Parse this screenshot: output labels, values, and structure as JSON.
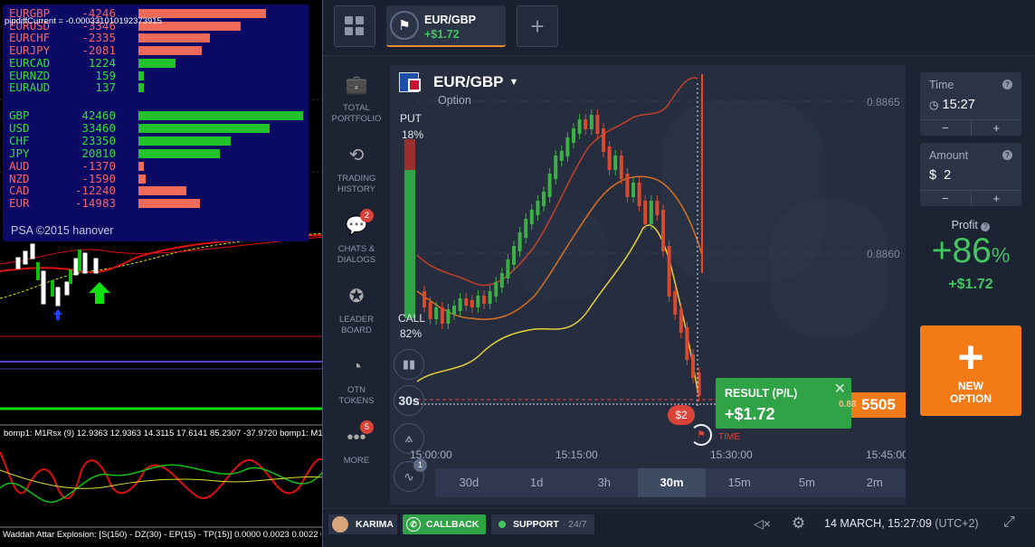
{
  "mt4": {
    "pipdiff": "pipdiffCurrent = -0.000331010192373915",
    "pairs": [
      {
        "name": "EURGBP",
        "value": "-4246",
        "fill": 0.75,
        "positive": false
      },
      {
        "name": "EURUSD",
        "value": "-3346",
        "fill": 0.6,
        "positive": false
      },
      {
        "name": "EURCHF",
        "value": "-2335",
        "fill": 0.42,
        "positive": false
      },
      {
        "name": "EURJPY",
        "value": "-2081",
        "fill": 0.37,
        "positive": false
      },
      {
        "name": "EURCAD",
        "value": "1224",
        "fill": 0.22,
        "positive": true
      },
      {
        "name": "EURNZD",
        "value": "159",
        "fill": 0.03,
        "positive": true
      },
      {
        "name": "EURAUD",
        "value": "137",
        "fill": 0.03,
        "positive": true
      }
    ],
    "currencies": [
      {
        "name": "GBP",
        "value": "42460",
        "fill": 0.97,
        "positive": true
      },
      {
        "name": "USD",
        "value": "33460",
        "fill": 0.77,
        "positive": true
      },
      {
        "name": "CHF",
        "value": "23350",
        "fill": 0.54,
        "positive": true
      },
      {
        "name": "JPY",
        "value": "20810",
        "fill": 0.48,
        "positive": true
      },
      {
        "name": "AUD",
        "value": "-1370",
        "fill": 0.03,
        "positive": false
      },
      {
        "name": "NZD",
        "value": "-1590",
        "fill": 0.04,
        "positive": false
      },
      {
        "name": "CAD",
        "value": "-12240",
        "fill": 0.28,
        "positive": false
      },
      {
        "name": "EUR",
        "value": "-14983",
        "fill": 0.36,
        "positive": false
      }
    ],
    "copyright": "PSA ©2015 hanover",
    "indicator_title": "bomp1: M1Rsx (9) 12.9363 12.9363 14.3115 17.6141 85.2307 -37.9720   bomp1: M1R",
    "bottom_label": "Waddah Attar Explosion: [S(150) - DZ(30) - EP(15) - TP(15)] 0.0000 0.0023 0.0022 0.0"
  },
  "iq": {
    "tab": {
      "pair": "EUR/GBP",
      "pl": "+$1.72"
    },
    "nav": [
      {
        "label1": "TOTAL",
        "label2": "PORTFOLIO",
        "icon": "briefcase-icon",
        "badge": ""
      },
      {
        "label1": "TRADING",
        "label2": "HISTORY",
        "icon": "history-icon",
        "badge": ""
      },
      {
        "label1": "CHATS &",
        "label2": "DIALOGS",
        "icon": "chat-icon",
        "badge": "2"
      },
      {
        "label1": "LEADER",
        "label2": "BOARD",
        "icon": "medal-icon",
        "badge": ""
      },
      {
        "label1": "OTN",
        "label2": "TOKENS",
        "icon": "token-icon",
        "badge": ""
      },
      {
        "label1": "MORE",
        "label2": "",
        "icon": "more-icon",
        "badge": "5"
      }
    ],
    "chart": {
      "pair": "EUR/GBP",
      "type": "Option",
      "put_label": "PUT",
      "put_pct": "18%",
      "call_label": "CALL",
      "call_pct": "82%",
      "price_levels": [
        "0.8865",
        "0.8860"
      ],
      "current_price": "0.88",
      "current_price_big": "5505",
      "times": [
        "15:00:00",
        "15:15:00",
        "15:30:00",
        "15:45:00"
      ],
      "timeframe": "30s",
      "bet": "$2",
      "expiration": "EXPIRATION TIME",
      "result_label": "RESULT (P/L)",
      "result_value": "+$1.72",
      "periods": [
        "30d",
        "1d",
        "3h",
        "30m",
        "15m",
        "5m",
        "2m"
      ],
      "active_period": "30m",
      "tool_badge": "1"
    },
    "time_panel": {
      "label": "Time",
      "value": "15:27",
      "minus": "−",
      "plus": "+"
    },
    "amount_panel": {
      "label": "Amount",
      "currency": "$",
      "value": "2",
      "minus": "−",
      "plus": "+"
    },
    "profit": {
      "label": "Profit",
      "pct": "+86",
      "pct_sign": "%",
      "amount": "+$1.72"
    },
    "new_option": {
      "line1": "NEW",
      "line2": "OPTION"
    },
    "status": {
      "user": "KARIMA",
      "callback": "CALLBACK",
      "support": "SUPPORT",
      "support_hours": "· 24/7",
      "datetime": "14 MARCH, 15:27:09",
      "utc": "(UTC+2)"
    },
    "colors": {
      "accent": "#f27b18",
      "green": "#43c560",
      "red": "#d9433a",
      "panel": "#2b3447"
    }
  }
}
